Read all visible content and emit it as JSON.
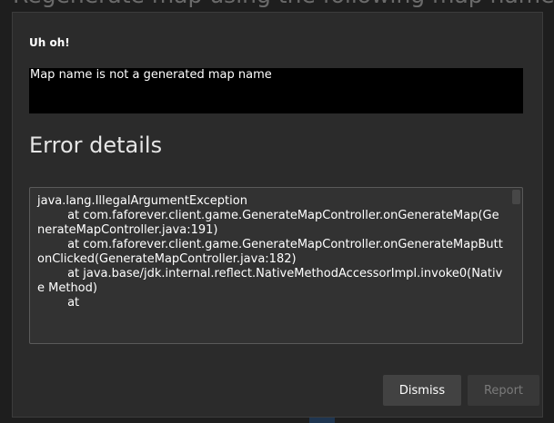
{
  "background": {
    "heading": "Regenerate map using the following map name:"
  },
  "dialog": {
    "title": "Uh oh!",
    "message": "Map name is not a generated map name",
    "details_title": "Error details",
    "details_text": "java.lang.IllegalArgumentException\n\tat com.faforever.client.game.GenerateMapController.onGenerateMap(GenerateMapController.java:191)\n\tat com.faforever.client.game.GenerateMapController.onGenerateMapButtonClicked(GenerateMapController.java:182)\n\tat java.base/jdk.internal.reflect.NativeMethodAccessorImpl.invoke0(Native Method)\n\tat",
    "dismiss_label": "Dismiss",
    "report_label": "Report"
  },
  "colors": {
    "dialog_bg": "#2b2b2b",
    "message_bg": "#000000",
    "details_bg": "#323232",
    "dismiss_bg": "#424242",
    "report_text_disabled": "#7a7a7a"
  }
}
